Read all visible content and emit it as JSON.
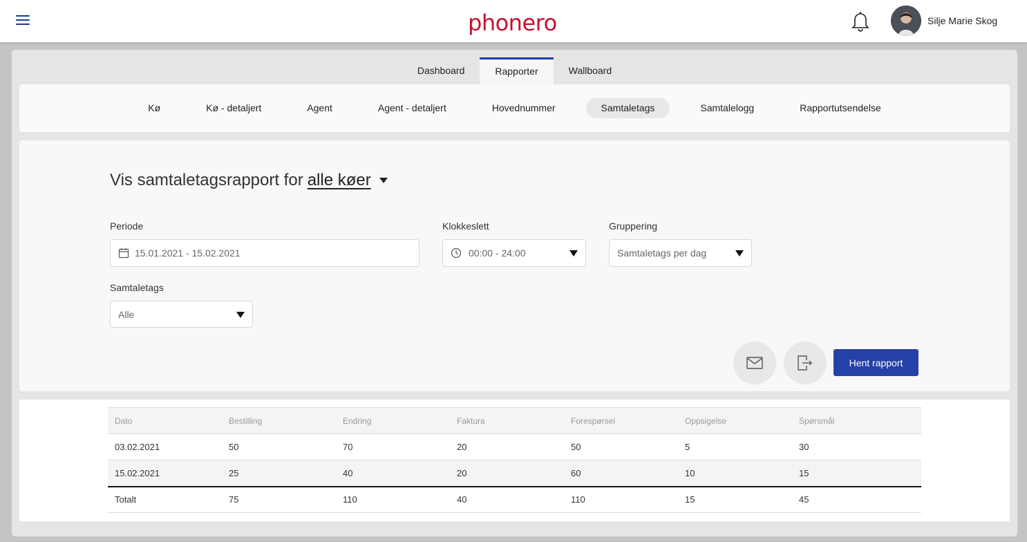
{
  "header": {
    "logo_text": "phonero",
    "user_name": "Silje Marie Skog"
  },
  "main_tabs": [
    {
      "label": "Dashboard",
      "active": false
    },
    {
      "label": "Rapporter",
      "active": true
    },
    {
      "label": "Wallboard",
      "active": false
    }
  ],
  "sub_tabs": [
    {
      "label": "Kø",
      "active": false
    },
    {
      "label": "Kø - detaljert",
      "active": false
    },
    {
      "label": "Agent",
      "active": false
    },
    {
      "label": "Agent - detaljert",
      "active": false
    },
    {
      "label": "Hovednummer",
      "active": false
    },
    {
      "label": "Samtaletags",
      "active": true
    },
    {
      "label": "Samtalelogg",
      "active": false
    },
    {
      "label": "Rapportutsendelse",
      "active": false
    }
  ],
  "form": {
    "title_prefix": "Vis samtaletagsrapport for",
    "title_queue": "alle køer",
    "periode_label": "Periode",
    "periode_value": "15.01.2021 - 15.02.2021",
    "klokkeslett_label": "Klokkeslett",
    "klokkeslett_value": "00:00 - 24:00",
    "gruppering_label": "Gruppering",
    "gruppering_value": "Samtaletags per dag",
    "samtaletags_label": "Samtaletags",
    "samtaletags_value": "Alle",
    "submit_label": "Hent rapport"
  },
  "table": {
    "columns": [
      "Dato",
      "Bestilling",
      "Endring",
      "Faktura",
      "Forespørsel",
      "Oppsigelse",
      "Spørsmål"
    ],
    "rows": [
      [
        "03.02.2021",
        "50",
        "70",
        "20",
        "50",
        "5",
        "30"
      ],
      [
        "15.02.2021",
        "25",
        "40",
        "20",
        "60",
        "10",
        "15"
      ]
    ],
    "total": [
      "Totalt",
      "75",
      "110",
      "40",
      "110",
      "15",
      "45"
    ]
  },
  "colors": {
    "accent": "#2540a6",
    "brand": "#c8102e"
  }
}
